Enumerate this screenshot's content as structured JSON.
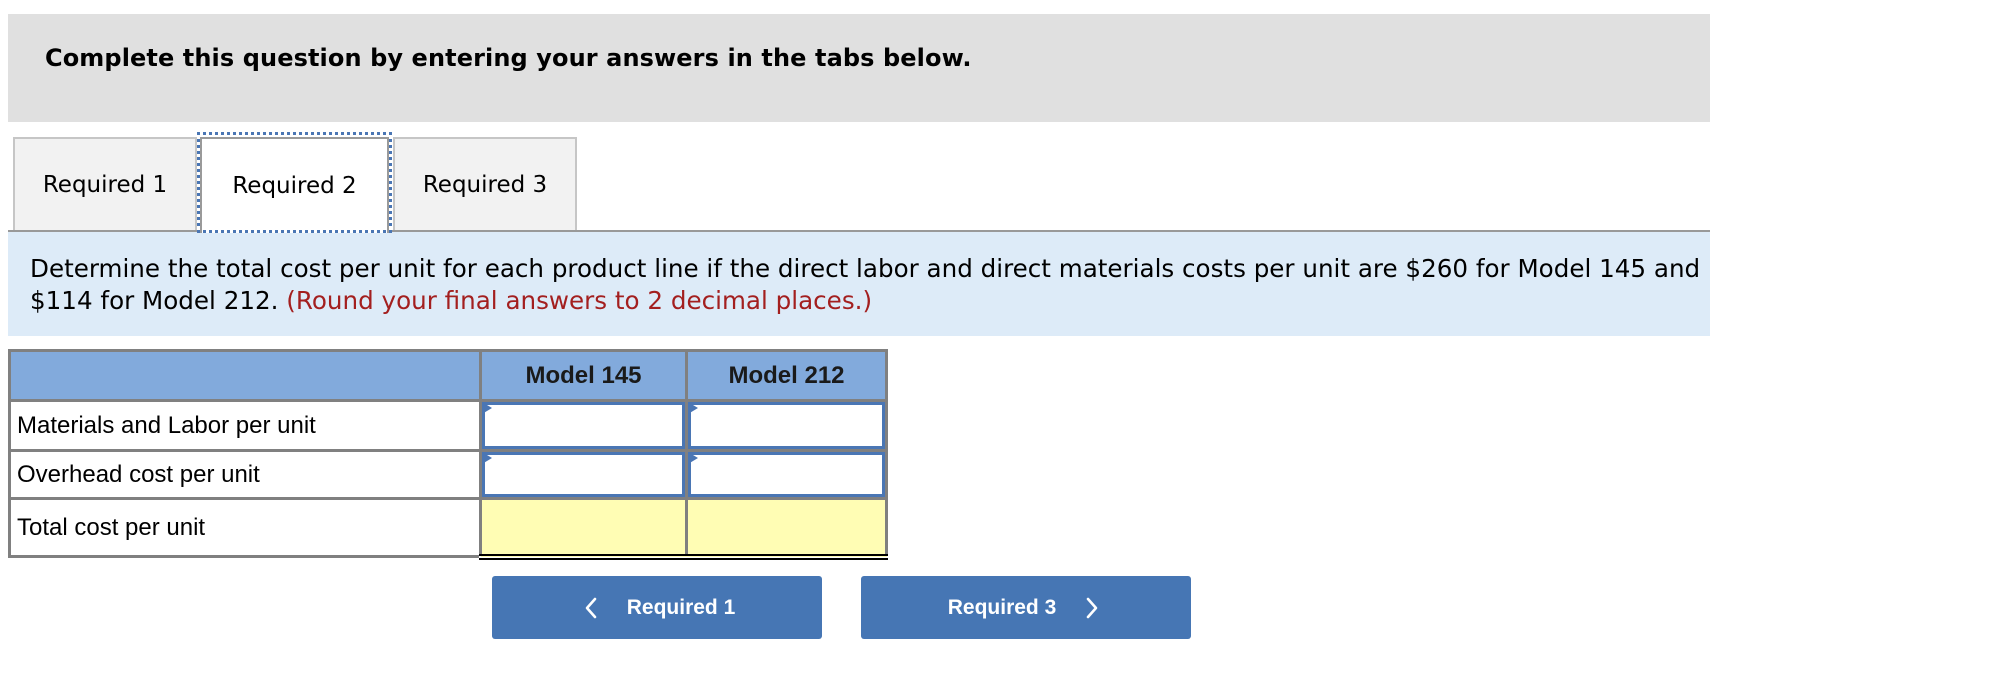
{
  "header": {
    "title": "Complete this question by entering your answers in the tabs below."
  },
  "tabs": [
    {
      "label": "Required 1",
      "active": false
    },
    {
      "label": "Required 2",
      "active": true
    },
    {
      "label": "Required 3",
      "active": false
    }
  ],
  "instructions": {
    "text": "Determine the total cost per unit for each product line if the direct labor and direct materials costs per unit are $260 for Model 145 and $114 for Model 212.",
    "note": "(Round your final answers to 2 decimal places.)"
  },
  "table": {
    "columns": [
      "",
      "Model 145",
      "Model 212"
    ],
    "rows": [
      {
        "label": "Materials and Labor per unit",
        "values": [
          "",
          ""
        ],
        "editable": true
      },
      {
        "label": "Overhead cost per unit",
        "values": [
          "",
          ""
        ],
        "editable": true
      },
      {
        "label": "Total cost per unit",
        "values": [
          "",
          ""
        ],
        "editable": false
      }
    ]
  },
  "navigation": {
    "prev_label": "Required 1",
    "next_label": "Required 3",
    "prev_icon": "chevron-left-icon",
    "next_icon": "chevron-right-icon"
  },
  "colors": {
    "header_bg": "#e0e0e0",
    "instruction_bg": "#ddebf8",
    "note_red": "#a31f1f",
    "table_header_bg": "#82aadc",
    "input_border": "#4a76b4",
    "total_bg": "#fffdb4",
    "button_bg": "#4676b4"
  }
}
